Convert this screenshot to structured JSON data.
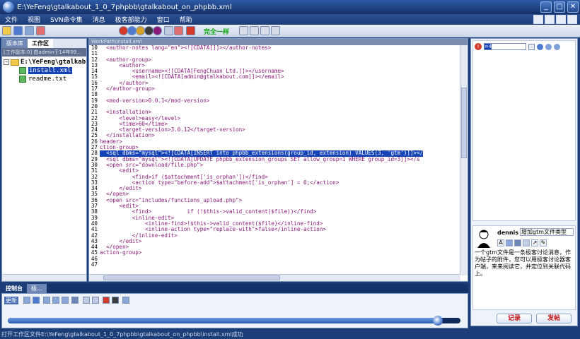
{
  "window": {
    "title": "E:\\YeFeng\\gtalkabout_1_0_7phpbb\\gtalkabout_on_phpbb.xml"
  },
  "menu": [
    "文件",
    "视图",
    "SVN命令集",
    "消息",
    "极客部能力",
    "窗口",
    "帮助"
  ],
  "toolbar": {
    "green_label": "完全一样"
  },
  "left_panel": {
    "tabs": [
      "版本库",
      "工作区"
    ],
    "info": "[工作副本:0] 由admin于14年09...",
    "tree": {
      "root": "E:\\YeFeng\\gtalkab",
      "children": [
        "install.xml",
        "readme.txt"
      ],
      "selected": "install.xml"
    }
  },
  "editor": {
    "path": "WorkPath\\install.xml",
    "lines": [
      {
        "n": "10",
        "t": "  <author-notes lang=\"en\"><![CDATA[]]></author-notes>"
      },
      {
        "n": "11",
        "t": ""
      },
      {
        "n": "12",
        "t": "  <author-group>"
      },
      {
        "n": "13",
        "t": "      <author>"
      },
      {
        "n": "14",
        "t": "          <username><![CDATA[FengChuan Ltd.]]></username>"
      },
      {
        "n": "15",
        "t": "          <email><![CDATA[admin@gtalkabout.com]]></email>"
      },
      {
        "n": "16",
        "t": "      </author>"
      },
      {
        "n": "17",
        "t": "  </author-group>"
      },
      {
        "n": "18",
        "t": ""
      },
      {
        "n": "19",
        "t": "  <mod-version>0.0.1</mod-version>"
      },
      {
        "n": "20",
        "t": ""
      },
      {
        "n": "21",
        "t": "  <installation>"
      },
      {
        "n": "22",
        "t": "      <level>easy</level>"
      },
      {
        "n": "23",
        "t": "      <time>60</time>"
      },
      {
        "n": "24",
        "t": "      <target-version>3.0.12</target-version>"
      },
      {
        "n": "25",
        "t": "  </installation>"
      },
      {
        "n": "26",
        "t": "header>"
      },
      {
        "n": "27",
        "t": "ction-group>"
      },
      {
        "n": "28",
        "t": "  <sql dbms=\"mysql\"><![CDATA[INSERT into phpbb_extensions(group_id, extension) VALUES(3, 'gtm')]]></",
        "hl": true
      },
      {
        "n": "29",
        "t": "  <sql dbms=\"mysql\"><![CDATA[UPDATE phpbb_extension_groups SET allow_group=1 WHERE group_id=3]]></s"
      },
      {
        "n": "30",
        "t": "  <open src=\"download/file.php\">"
      },
      {
        "n": "31",
        "t": "      <edit>"
      },
      {
        "n": "32",
        "t": "          <find>if ($attachment['is_orphan'])</find>"
      },
      {
        "n": "33",
        "t": "          <action type=\"before-add\">$attachment['is_orphan'] = 0;</action>"
      },
      {
        "n": "34",
        "t": "      </edit>"
      },
      {
        "n": "35",
        "t": "  </open>"
      },
      {
        "n": "36",
        "t": "  <open src=\"includes/functions_upload.php\">"
      },
      {
        "n": "37",
        "t": "      <edit>"
      },
      {
        "n": "38",
        "t": "          <find>           if (!$this->valid_content($file))</find>"
      },
      {
        "n": "39",
        "t": "          <inline-edit>"
      },
      {
        "n": "40",
        "t": "              <inline-find>!$this->valid_content($file)</inline-find>"
      },
      {
        "n": "41",
        "t": "              <inline-action type=\"replace-with\">false</inline-action>"
      },
      {
        "n": "42",
        "t": "          </inline-edit>"
      },
      {
        "n": "43",
        "t": "      </edit>"
      },
      {
        "n": "44",
        "t": "  </open>"
      },
      {
        "n": "45",
        "t": "action-group>"
      },
      {
        "n": "46",
        "t": ""
      },
      {
        "n": "47",
        "t": ""
      }
    ]
  },
  "right_panel": {
    "id_value": "=4",
    "user": "dennis",
    "subject": "增加gtm文件类型",
    "message": "一个gtm文件是一条极客讨论消息，作为帖子的附件，您可以用极客讨论器客户端，来来阅读它，并定位到关联代码上。",
    "record_button": "记录",
    "post_button": "发帖"
  },
  "console": {
    "tabs": [
      "控制台",
      "极..."
    ],
    "label": "更新",
    "progress": 0.95
  },
  "status": {
    "text": "打开工作区文件E:\\YeFeng\\gtalkabout_1_0_7phpbb\\gtalkabout_on_phpbb\\install.xml成功"
  },
  "colors": {
    "accent": "#1b3d78",
    "selection": "#1644b6",
    "code_text": "#8b1a7b",
    "post_text": "#c21212"
  }
}
